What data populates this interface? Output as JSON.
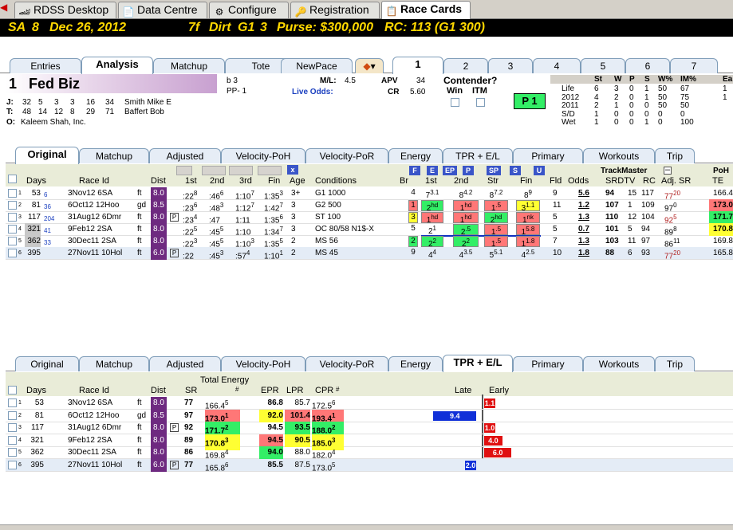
{
  "app_tabs": [
    {
      "label": "RDSS Desktop",
      "icon": "desktop-icon"
    },
    {
      "label": "Data Centre",
      "icon": "data-icon"
    },
    {
      "label": "Configure",
      "icon": "gear-icon"
    },
    {
      "label": "Registration",
      "icon": "key-icon"
    },
    {
      "label": "Race Cards",
      "icon": "card-icon"
    }
  ],
  "header": {
    "track": "SA",
    "race": "8",
    "date": "Dec 26, 2012",
    "distance": "7f",
    "surface": "Dirt",
    "grade": "G1",
    "field": "3",
    "purse": "Purse: $300,000",
    "rc": "RC: 113 (G1 300)"
  },
  "view_tabs": [
    "Entries",
    "Analysis",
    "Matchup",
    "Tote",
    "NewPace"
  ],
  "horse_tabs": [
    "1",
    "2",
    "3",
    "4",
    "5",
    "6",
    "7"
  ],
  "horse": {
    "number": "1",
    "name": "Fed Biz",
    "age_label": "b 3",
    "pp": "PP- 1",
    "ml_label": "M/L:",
    "ml": "4.5",
    "apv_label": "APV",
    "apv": "34",
    "live_odds": "Live Odds:",
    "cr_label": "CR",
    "cr": "5.60",
    "jockey": {
      "label": "J:",
      "stats": [
        "32",
        "5",
        "3",
        "3",
        "16",
        "34"
      ],
      "name": "Smith Mike E"
    },
    "trainer": {
      "label": "T:",
      "stats": [
        "48",
        "14",
        "12",
        "8",
        "29",
        "71"
      ],
      "name": "Baffert Bob"
    },
    "owner": {
      "label": "O:",
      "name": "Kaleem Shah, Inc."
    }
  },
  "contender": {
    "title": "Contender?",
    "win": "Win",
    "itm": "ITM",
    "badge": "P 1"
  },
  "record": {
    "headers": [
      "St",
      "W",
      "P",
      "S",
      "W%",
      "IM%",
      "Ea"
    ],
    "rows": [
      {
        "label": "Life",
        "vals": [
          "6",
          "3",
          "0",
          "1",
          "50",
          "67",
          "1"
        ]
      },
      {
        "label": "2012",
        "vals": [
          "4",
          "2",
          "0",
          "1",
          "50",
          "75",
          "1"
        ]
      },
      {
        "label": "2011",
        "vals": [
          "2",
          "1",
          "0",
          "0",
          "50",
          "50",
          ""
        ]
      },
      {
        "label": "S/D",
        "vals": [
          "1",
          "0",
          "0",
          "0",
          "0",
          "0",
          ""
        ]
      },
      {
        "label": "Wet",
        "vals": [
          "1",
          "0",
          "0",
          "1",
          "0",
          "100",
          ""
        ]
      }
    ]
  },
  "upper_tabs": [
    "Original",
    "Matchup",
    "Adjusted",
    "Velocity-PoH",
    "Velocity-PoR",
    "Energy",
    "TPR + E/L",
    "Primary",
    "Workouts",
    "Trip"
  ],
  "upper_cols": {
    "days": "Days",
    "race_id": "Race Id",
    "dist": "Dist",
    "c1": "1st",
    "c2": "2nd",
    "c3": "3rd",
    "fin": "Fin",
    "age": "Age",
    "cond": "Conditions",
    "br": "Br",
    "p1": "1st",
    "p2": "2nd",
    "str": "Str",
    "pfin": "Fin",
    "fld": "Fld",
    "odds": "Odds",
    "tm": "TrackMaster",
    "srdtv": "SRDTV",
    "rc": "RC",
    "adjsr": "Adj. SR",
    "poh": "PoH",
    "te": "TE"
  },
  "pace_buttons": [
    "F",
    "E",
    "EP",
    "P",
    "SP",
    "S",
    "U"
  ],
  "upper_rows": [
    {
      "n": "1",
      "days": "53",
      "sup": "6",
      "id": "3Nov12 6SA",
      "surf": "ft",
      "dist": "8.0",
      "q1": ":22",
      "q1s": "8",
      "q2": ":46",
      "q2s": "6",
      "q3": "1:10",
      "q3s": "7",
      "fin": "1:35",
      "fins": "3",
      "age": "3+",
      "cond": "G1 1000",
      "br": "4",
      "p1": "7",
      "p1s": "3.1",
      "p2": "8",
      "p2s": "4.2",
      "str": "8",
      "strs": "7.2",
      "pf": "8",
      "pfs": "9",
      "fld": "9",
      "odds": "5.6",
      "sr": "94",
      "dtv": "15",
      "rc": "117",
      "adj": "77",
      "adjs": "20",
      "te": "166.4"
    },
    {
      "n": "2",
      "days": "81",
      "sup": "36",
      "id": "6Oct12 12Hoo",
      "surf": "gd",
      "dist": "8.5",
      "q1": ":23",
      "q1s": "6",
      "q2": ":48",
      "q2s": "3",
      "q3": "1:12",
      "q3s": "7",
      "fin": "1:42",
      "fins": "7",
      "age": "3",
      "cond": "G2 500",
      "br": "1",
      "p1": "2",
      "p1s": "hd",
      "p2": "1",
      "p2s": "hd",
      "str": "1",
      "strs": ".5",
      "pf": "3",
      "pfs": "1.1",
      "fld": "11",
      "odds": "1.2",
      "sr": "107",
      "dtv": "1",
      "rc": "109",
      "adj": "97",
      "adjs": "0",
      "te": "173.0"
    },
    {
      "n": "3",
      "days": "117",
      "sup": "204",
      "id": "31Aug12 6Dmr",
      "surf": "ft",
      "dist": "8.0",
      "q1": ":23",
      "q1s": "4",
      "q2": ":47",
      "q2s": "",
      "q3": "1:11",
      "q3s": "",
      "fin": "1:35",
      "fins": "6",
      "age": "3",
      "cond": "ST 100",
      "br": "3",
      "p1": "1",
      "p1s": "hd",
      "p2": "1",
      "p2s": "hd",
      "str": "2",
      "strs": "hd",
      "pf": "1",
      "pfs": "nk",
      "fld": "5",
      "odds": "1.3",
      "sr": "110",
      "dtv": "12",
      "rc": "104",
      "adj": "92",
      "adjs": "5",
      "te": "171.7"
    },
    {
      "n": "4",
      "days": "321",
      "sup": "41",
      "id": "9Feb12 2SA",
      "surf": "ft",
      "dist": "8.0",
      "q1": ":22",
      "q1s": "5",
      "q2": ":45",
      "q2s": "5",
      "q3": "1:10",
      "q3s": "",
      "fin": "1:34",
      "fins": "7",
      "age": "3",
      "cond": "OC 80/58 N1$-X",
      "br": "5",
      "p1": "2",
      "p1s": "1",
      "p2": "2",
      "p2s": ".5",
      "str": "1",
      "strs": ".5",
      "pf": "1",
      "pfs": "5.8",
      "fld": "5",
      "odds": "0.7",
      "sr": "101",
      "dtv": "5",
      "rc": "94",
      "adj": "89",
      "adjs": "8",
      "te": "170.8"
    },
    {
      "n": "5",
      "days": "362",
      "sup": "33",
      "id": "30Dec11 2SA",
      "surf": "ft",
      "dist": "8.0",
      "q1": ":22",
      "q1s": "3",
      "q2": ":45",
      "q2s": "5",
      "q3": "1:10",
      "q3s": "3",
      "fin": "1:35",
      "fins": "5",
      "age": "2",
      "cond": "MS 56",
      "br": "2",
      "p1": "2",
      "p1s": "2",
      "p2": "2",
      "p2s": "2",
      "str": "1",
      "strs": ".5",
      "pf": "1",
      "pfs": "1.8",
      "fld": "7",
      "odds": "1.3",
      "sr": "103",
      "dtv": "11",
      "rc": "97",
      "adj": "86",
      "adjs": "11",
      "te": "169.8"
    },
    {
      "n": "6",
      "days": "395",
      "sup": "",
      "id": "27Nov11 10Hol",
      "surf": "ft",
      "dist": "6.0",
      "q1": ":22",
      "q1s": "",
      "q2": ":45",
      "q2s": "3",
      "q3": ":57",
      "q3s": "4",
      "fin": "1:10",
      "fins": "1",
      "age": "2",
      "cond": "MS 45",
      "br": "9",
      "p1": "4",
      "p1s": "4",
      "p2": "4",
      "p2s": "3.5",
      "str": "5",
      "strs": "5.1",
      "pf": "4",
      "pfs": "2.5",
      "fld": "10",
      "odds": "1.8",
      "sr": "88",
      "dtv": "6",
      "rc": "93",
      "adj": "77",
      "adjs": "20",
      "te": "165.8"
    }
  ],
  "lower_tabs": [
    "Original",
    "Matchup",
    "Adjusted",
    "Velocity-PoH",
    "Velocity-PoR",
    "Energy",
    "TPR + E/L",
    "Primary",
    "Workouts",
    "Trip"
  ],
  "lower_cols": {
    "days": "Days",
    "race_id": "Race Id",
    "dist": "Dist",
    "sr": "SR",
    "total_energy": "Total Energy",
    "hash": "#",
    "epr": "EPR",
    "lpr": "LPR",
    "cpr": "CPR",
    "late": "Late",
    "early": "Early"
  },
  "lower_rows": [
    {
      "n": "1",
      "days": "53",
      "id": "3Nov12 6SA",
      "surf": "ft",
      "dist": "8.0",
      "sr": "77",
      "te": "166.4",
      "ter": "5",
      "epr": "86.8",
      "lpr": "85.7",
      "cpr": "172.5",
      "cprr": "6",
      "bar": "1.1",
      "dir": "early",
      "v": 1.1
    },
    {
      "n": "2",
      "days": "81",
      "id": "6Oct12 12Hoo",
      "surf": "gd",
      "dist": "8.5",
      "sr": "97",
      "te": "173.0",
      "ter": "1",
      "epr": "92.0",
      "lpr": "101.4",
      "cpr": "193.4",
      "cprr": "1",
      "bar": "9.4",
      "dir": "late",
      "v": 9.4
    },
    {
      "n": "3",
      "days": "117",
      "id": "31Aug12 6Dmr",
      "surf": "ft",
      "dist": "8.0",
      "sr": "92",
      "te": "171.7",
      "ter": "2",
      "epr": "94.5",
      "lpr": "93.5",
      "cpr": "188.0",
      "cprr": "2",
      "bar": "1.0",
      "dir": "early",
      "v": 1.0
    },
    {
      "n": "4",
      "days": "321",
      "id": "9Feb12 2SA",
      "surf": "ft",
      "dist": "8.0",
      "sr": "89",
      "te": "170.8",
      "ter": "3",
      "epr": "94.5",
      "lpr": "90.5",
      "cpr": "185.0",
      "cprr": "3",
      "bar": "4.0",
      "dir": "early",
      "v": 4.0
    },
    {
      "n": "5",
      "days": "362",
      "id": "30Dec11 2SA",
      "surf": "ft",
      "dist": "8.0",
      "sr": "86",
      "te": "169.8",
      "ter": "4",
      "epr": "94.0",
      "lpr": "88.0",
      "cpr": "182.0",
      "cprr": "4",
      "bar": "6.0",
      "dir": "early",
      "v": 6.0
    },
    {
      "n": "6",
      "days": "395",
      "id": "27Nov11 10Hol",
      "surf": "ft",
      "dist": "6.0",
      "sr": "77",
      "te": "165.8",
      "ter": "6",
      "epr": "85.5",
      "lpr": "87.5",
      "cpr": "173.0",
      "cprr": "5",
      "bar": "2.0",
      "dir": "late",
      "v": 2.0
    }
  ],
  "colors": {
    "accent": "#ffd800",
    "dist": "#6e2a80",
    "red": "#ff7777",
    "yellow": "#ffff33",
    "green": "#33ee66",
    "late_bar": "#1030d8",
    "early_bar": "#e01010"
  }
}
